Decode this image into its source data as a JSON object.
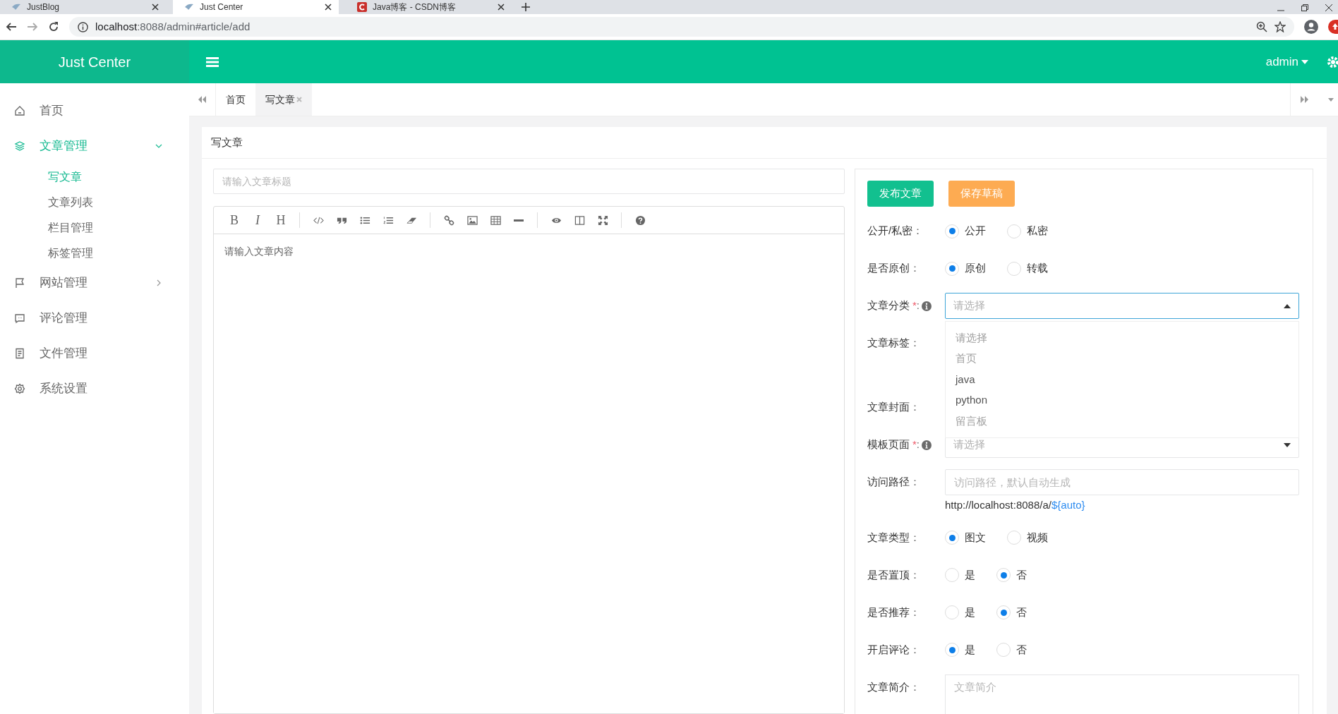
{
  "browser": {
    "tabs": [
      {
        "title": "JustBlog",
        "selected": false
      },
      {
        "title": "Just Center",
        "selected": true
      },
      {
        "title": "Java博客 - CSDN博客",
        "selected": false
      }
    ],
    "url_host": "localhost",
    "url_rest": ":8088/admin#article/add"
  },
  "header": {
    "brand": "Just Center",
    "user": "admin"
  },
  "sidebar": [
    {
      "label": "首页",
      "selected": false
    },
    {
      "label": "文章管理",
      "selected": true,
      "expanded": true,
      "children": [
        {
          "label": "写文章",
          "selected": true
        },
        {
          "label": "文章列表",
          "selected": false
        },
        {
          "label": "栏目管理",
          "selected": false
        },
        {
          "label": "标签管理",
          "selected": false
        }
      ]
    },
    {
      "label": "网站管理",
      "selected": false,
      "expanded": false
    },
    {
      "label": "评论管理",
      "selected": false
    },
    {
      "label": "文件管理",
      "selected": false
    },
    {
      "label": "系统设置",
      "selected": false
    }
  ],
  "page_tabs": [
    {
      "label": "首页",
      "selected": false,
      "closable": false
    },
    {
      "label": "写文章",
      "selected": true,
      "closable": true
    }
  ],
  "panel_title": "写文章",
  "editor": {
    "title_placeholder": "请输入文章标题",
    "content_placeholder": "请输入文章内容",
    "toolbar": [
      {
        "kind": "text",
        "label": "B"
      },
      {
        "kind": "text",
        "label": "I"
      },
      {
        "kind": "text",
        "label": "H"
      },
      {
        "kind": "separator"
      },
      {
        "kind": "code"
      },
      {
        "kind": "quote"
      },
      {
        "kind": "list"
      },
      {
        "kind": "ordered-list"
      },
      {
        "kind": "eraser"
      },
      {
        "kind": "separator"
      },
      {
        "kind": "link"
      },
      {
        "kind": "image"
      },
      {
        "kind": "table"
      },
      {
        "kind": "rule"
      },
      {
        "kind": "separator"
      },
      {
        "kind": "preview"
      },
      {
        "kind": "columns"
      },
      {
        "kind": "fullscreen"
      },
      {
        "kind": "separator"
      },
      {
        "kind": "help"
      }
    ]
  },
  "actions": [
    {
      "label": "发布文章",
      "kind": "publish"
    },
    {
      "label": "保存草稿",
      "kind": "draft"
    }
  ],
  "fields": [
    {
      "kind": "radio",
      "label": "公开/私密",
      "colon": "：",
      "options": [
        {
          "label": "公开",
          "selected": true
        },
        {
          "label": "私密",
          "selected": false
        }
      ]
    },
    {
      "kind": "radio",
      "label": "是否原创",
      "colon": "：",
      "options": [
        {
          "label": "原创",
          "selected": true
        },
        {
          "label": "转载",
          "selected": false
        }
      ]
    },
    {
      "kind": "select",
      "label": "文章分类",
      "required": "*",
      "colon": ":",
      "info": true,
      "placeholder": "请选择",
      "open": true,
      "options": [
        {
          "label": "请选择",
          "disabled": true
        },
        {
          "label": "首页",
          "disabled": true
        },
        {
          "label": "java",
          "disabled": false
        },
        {
          "label": "python",
          "disabled": false
        },
        {
          "label": "留言板",
          "disabled": true
        }
      ]
    },
    {
      "kind": "covered",
      "label": "文章标签",
      "colon": "："
    },
    {
      "kind": "covered",
      "label": "文章封面",
      "colon": "："
    },
    {
      "kind": "select",
      "label": "模板页面",
      "required": "*",
      "colon": ":",
      "info": true,
      "placeholder": "请选择",
      "open": false
    },
    {
      "kind": "text",
      "label": "访问路径",
      "colon": "：",
      "placeholder": "访问路径，默认自动生成",
      "hint": "http://localhost:8088/a/",
      "hint_link": "${auto}"
    },
    {
      "kind": "radio",
      "label": "文章类型",
      "colon": "：",
      "options": [
        {
          "label": "图文",
          "selected": true
        },
        {
          "label": "视频",
          "selected": false
        }
      ]
    },
    {
      "kind": "radio",
      "label": "是否置顶",
      "colon": "：",
      "options": [
        {
          "label": "是",
          "selected": false
        },
        {
          "label": "否",
          "selected": true
        }
      ]
    },
    {
      "kind": "radio",
      "label": "是否推荐",
      "colon": "：",
      "options": [
        {
          "label": "是",
          "selected": false
        },
        {
          "label": "否",
          "selected": true
        }
      ]
    },
    {
      "kind": "radio",
      "label": "开启评论",
      "colon": "：",
      "options": [
        {
          "label": "是",
          "selected": true
        },
        {
          "label": "否",
          "selected": false
        }
      ]
    },
    {
      "kind": "textarea",
      "label": "文章简介",
      "colon": "：",
      "placeholder": "文章简介"
    }
  ]
}
